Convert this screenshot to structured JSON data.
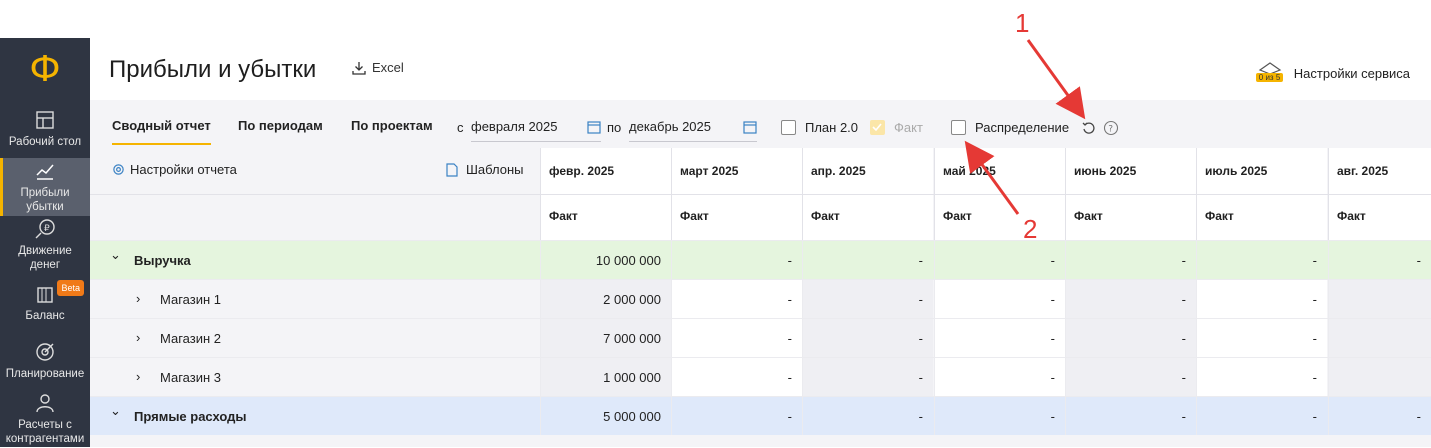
{
  "sidebar": {
    "logo": "Ф",
    "items": [
      {
        "label": "Рабочий стол",
        "icon": "desktop-icon"
      },
      {
        "label": "Прибыли\nубытки",
        "icon": "chart-icon",
        "active": true
      },
      {
        "label": "Движение\nденег",
        "icon": "money-icon"
      },
      {
        "label": "Баланс",
        "icon": "balance-icon",
        "badge": "Beta"
      },
      {
        "label": "Планирование",
        "icon": "target-icon"
      },
      {
        "label": "Расчеты с\nконтрагентами",
        "icon": "people-icon"
      }
    ]
  },
  "header": {
    "title": "Прибыли и убытки",
    "excel": "Excel",
    "service": "Настройки сервиса",
    "service_badge": "0 из 5"
  },
  "toolbar": {
    "tabs": [
      "Сводный отчет",
      "По периодам",
      "По проектам"
    ],
    "from_label": "с",
    "from_value": "февраля 2025",
    "to_label": "по",
    "to_value": "декабрь 2025",
    "plan_label": "План 2.0",
    "fact_label": "Факт",
    "distribution_label": "Распределение"
  },
  "table": {
    "settings_label": "Настройки отчета",
    "templates_label": "Шаблоны",
    "columns": [
      "февр. 2025",
      "март 2025",
      "апр. 2025",
      "май 2025",
      "июнь 2025",
      "июль 2025",
      "авг. 2025"
    ],
    "subheader": "Факт",
    "rows": [
      {
        "label": "Выручка",
        "values": [
          "10 000 000",
          "-",
          "-",
          "-",
          "-",
          "-",
          "-"
        ]
      },
      {
        "label": "Магазин 1",
        "values": [
          "2 000 000",
          "-",
          "-",
          "-",
          "-",
          "-",
          ""
        ]
      },
      {
        "label": "Магазин 2",
        "values": [
          "7 000 000",
          "-",
          "-",
          "-",
          "-",
          "-",
          ""
        ]
      },
      {
        "label": "Магазин 3",
        "values": [
          "1 000 000",
          "-",
          "-",
          "-",
          "-",
          "-",
          ""
        ]
      },
      {
        "label": "Прямые расходы",
        "values": [
          "5 000 000",
          "-",
          "-",
          "-",
          "-",
          "-",
          "-"
        ]
      }
    ]
  },
  "annotations": [
    "1",
    "2"
  ],
  "colors": {
    "accent": "#f5b400",
    "sidebar": "#2f3542",
    "arrow": "#e53935",
    "green_row": "#e5f5de",
    "blue_row": "#dfe9fa"
  }
}
